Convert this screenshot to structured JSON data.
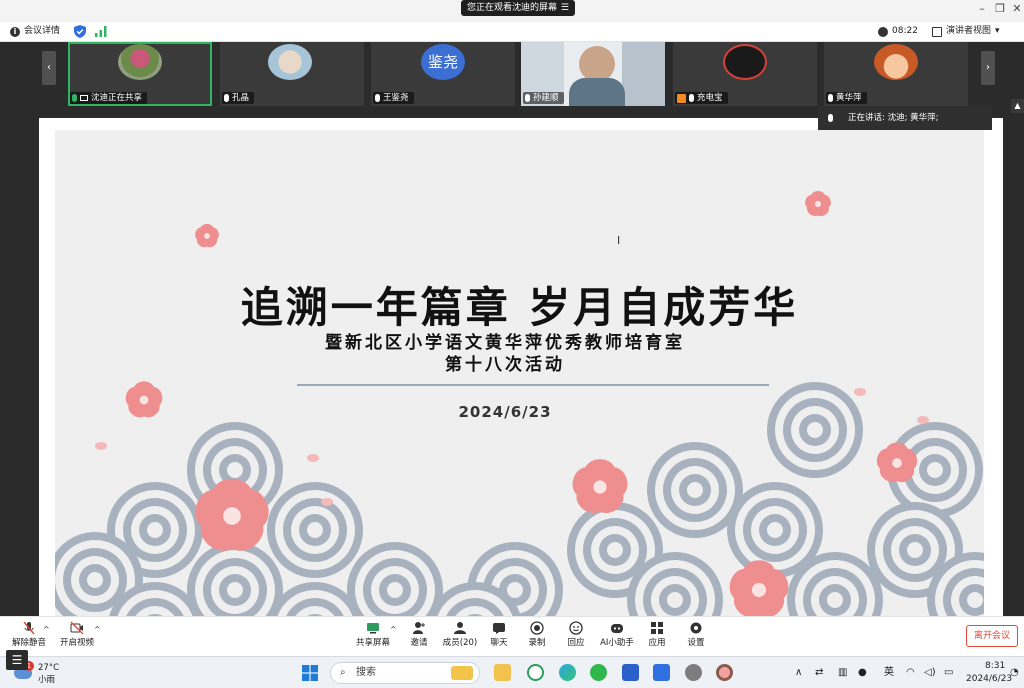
{
  "window": {
    "viewing_banner": "您正在观看沈迪的屏幕",
    "menu_glyph": "☰"
  },
  "infobar": {
    "meeting_details": "会议详情",
    "timer": "08:22",
    "view_mode": "演讲者视图"
  },
  "participants": [
    {
      "name": "沈迪正在共享",
      "avatar": "tulip-photo",
      "active": true
    },
    {
      "name": "孔晶",
      "avatar": "family-photo"
    },
    {
      "name": "王鉴尧",
      "avatar_text": "鉴尧"
    },
    {
      "name": "孙建顺",
      "avatar": "video-feed"
    },
    {
      "name": "充电宝",
      "avatar": "badge-logo"
    },
    {
      "name": "黄华萍",
      "avatar": "cartoon-girl"
    }
  ],
  "speaking": {
    "label": "正在讲话:",
    "names": "沈迪; 黄华萍;"
  },
  "slide": {
    "title": "追溯一年篇章  岁月自成芳华",
    "subtitle": "暨新北区小学语文黄华萍优秀教师培育室",
    "subtitle2": "第十八次活动",
    "date": "2024/6/23",
    "colors": {
      "wave": "#a8b2bf",
      "blossom": "#ef8e8e",
      "bg": "#efefef"
    }
  },
  "toolbar": {
    "unmute": "解除静音",
    "start_video": "开启视频",
    "share_screen": "共享屏幕",
    "invite": "邀请",
    "members": "成员(20)",
    "chat": "聊天",
    "record": "录制",
    "reply": "回应",
    "ai_assistant": "AI小助手",
    "apps": "应用",
    "settings": "设置",
    "leave": "离开会议"
  },
  "taskbar": {
    "weather_temp": "27°C",
    "weather_cond": "小雨",
    "weather_badge": "1",
    "search_placeholder": "搜索",
    "ime": "英",
    "time": "8:31",
    "date": "2024/6/23"
  }
}
